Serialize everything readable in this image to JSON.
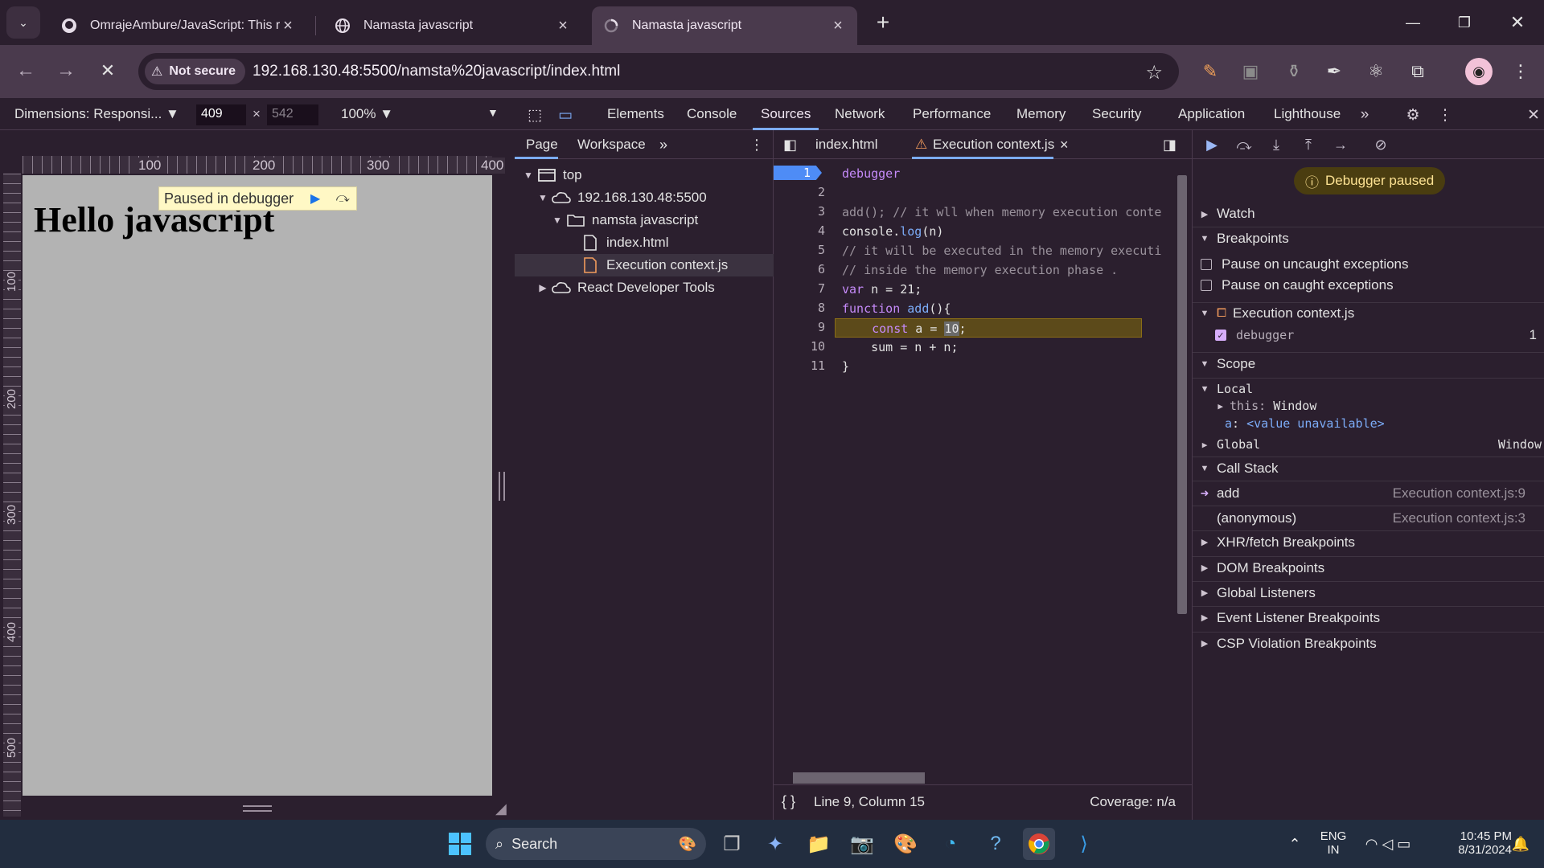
{
  "browser": {
    "tabs": [
      {
        "title": "OmrajeAmbure/JavaScript: This re",
        "icon": "github-icon"
      },
      {
        "title": "Namasta javascript",
        "icon": "globe-icon"
      },
      {
        "title": "Namasta javascript",
        "icon": "loading-icon",
        "active": true
      }
    ],
    "security_label": "Not secure",
    "url": "192.168.130.48:5500/namsta%20javascript/index.html"
  },
  "device_toolbar": {
    "dimensions_label": "Dimensions: Responsi...",
    "width": "409",
    "times": "×",
    "height": "542",
    "zoom": "100%"
  },
  "viewport": {
    "ruler_top": [
      "100",
      "200",
      "300",
      "400"
    ],
    "ruler_left": [
      "100",
      "200",
      "300",
      "400",
      "500"
    ],
    "heading": "Hello javascript",
    "paused_overlay": "Paused in debugger"
  },
  "devtools": {
    "tabs": [
      "Elements",
      "Console",
      "Sources",
      "Network",
      "Performance",
      "Memory",
      "Security",
      "Application",
      "Lighthouse"
    ],
    "active_tab": "Sources",
    "sidebar": {
      "tabs": [
        "Page",
        "Workspace"
      ],
      "tree": [
        {
          "label": "top",
          "level": 0,
          "arrow": "▼",
          "icon": "frame-icon"
        },
        {
          "label": "192.168.130.48:5500",
          "level": 1,
          "arrow": "▼",
          "icon": "cloud-icon"
        },
        {
          "label": "namsta javascript",
          "level": 2,
          "arrow": "▼",
          "icon": "folder-icon"
        },
        {
          "label": "index.html",
          "level": 3,
          "arrow": "",
          "icon": "file-icon"
        },
        {
          "label": "Execution context.js",
          "level": 3,
          "arrow": "",
          "icon": "js-file-icon",
          "selected": true
        },
        {
          "label": "React Developer Tools",
          "level": 1,
          "arrow": "▶",
          "icon": "cloud-icon"
        }
      ]
    },
    "editor": {
      "tabs": [
        "index.html",
        "Execution context.js"
      ],
      "line_numbers": [
        "1",
        "2",
        "3",
        "4",
        "5",
        "6",
        "7",
        "8",
        "9",
        "10",
        "11"
      ],
      "lines": [
        "debugger",
        "",
        "add(); // it wll when memory execution conte",
        "console.log(n)",
        "// it will be executed in the memory executi",
        "// inside the memory execution phase .",
        "var n = 21;",
        "function add(){",
        "    const a = 10;",
        "    sum = n + n;",
        "}"
      ],
      "status_position": "Line 9, Column 15",
      "status_coverage": "Coverage: n/a"
    },
    "debugger": {
      "paused_label": "Debugger paused",
      "watch": "Watch",
      "breakpoints": "Breakpoints",
      "pause_uncaught": "Pause on uncaught exceptions",
      "pause_caught": "Pause on caught exceptions",
      "bp_file": "Execution context.js",
      "bp_code": "debugger",
      "bp_line": "1",
      "scope": "Scope",
      "local": "Local",
      "this_key": "this",
      "this_val": "Window",
      "a_key": "a",
      "a_val": "<value unavailable>",
      "global": "Global",
      "global_val": "Window",
      "call_stack": "Call Stack",
      "frames": [
        {
          "name": "add",
          "loc": "Execution context.js:9"
        },
        {
          "name": "(anonymous)",
          "loc": "Execution context.js:3"
        }
      ],
      "more_sections": [
        "XHR/fetch Breakpoints",
        "DOM Breakpoints",
        "Global Listeners",
        "Event Listener Breakpoints",
        "CSP Violation Breakpoints"
      ]
    }
  },
  "taskbar": {
    "search": "Search",
    "lang1": "ENG",
    "lang2": "IN",
    "time": "10:45 PM",
    "date": "8/31/2024"
  }
}
